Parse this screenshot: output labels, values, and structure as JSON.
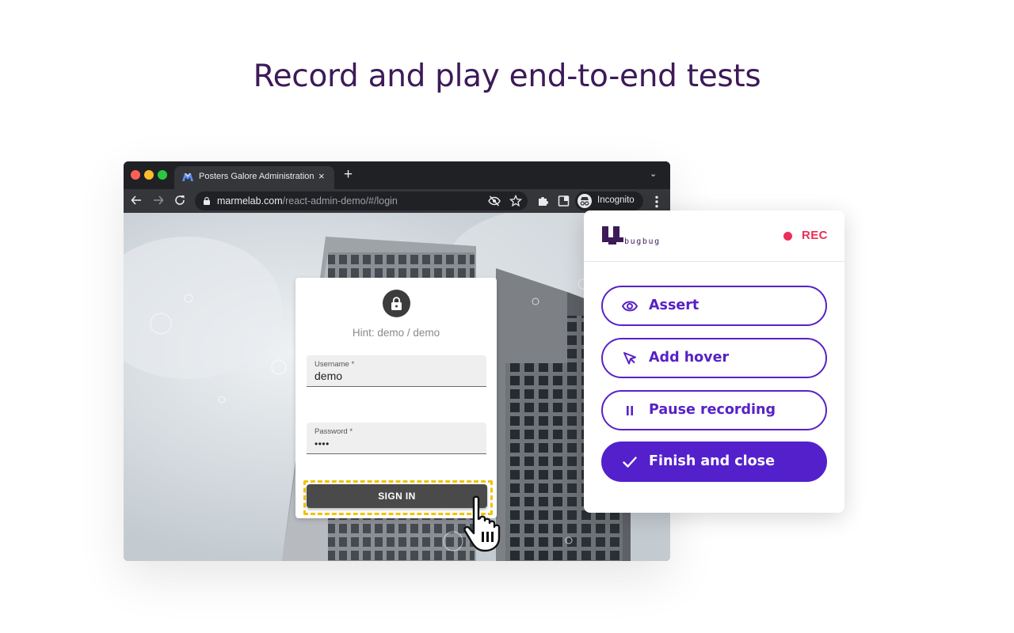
{
  "headline": "Record and play end-to-end tests",
  "browser": {
    "tab_title": "Posters Galore Administration",
    "tab_close": "×",
    "new_tab": "+",
    "tab_menu": "⌄",
    "url_host": "marmelab.com",
    "url_path": "/react-admin-demo/#/login",
    "incognito_label": "Incognito",
    "icons": [
      "back-icon",
      "forward-icon",
      "reload-icon",
      "lock-icon",
      "eye-off-icon",
      "star-icon",
      "extensions-icon",
      "sidepanel-icon",
      "incognito-icon",
      "menu-icon"
    ]
  },
  "login": {
    "hint": "Hint: demo / demo",
    "username_label": "Username *",
    "username_value": "demo",
    "password_label": "Password *",
    "password_value": "••••",
    "signin_label": "SIGN IN"
  },
  "extension": {
    "logo_text": "bugbug",
    "rec_label": "REC",
    "buttons": [
      {
        "label": "Assert",
        "icon": "eye-icon"
      },
      {
        "label": "Add hover",
        "icon": "pointer-icon"
      },
      {
        "label": "Pause recording",
        "icon": "pause-icon"
      },
      {
        "label": "Finish and close",
        "icon": "check-icon"
      }
    ]
  },
  "colors": {
    "headline": "#3d1a58",
    "accent": "#5721c6",
    "rec": "#ea2e55",
    "highlight": "#f2c200"
  }
}
